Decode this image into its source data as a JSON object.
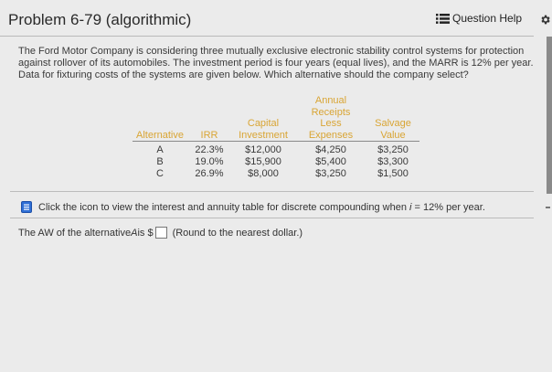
{
  "header": {
    "title": "Problem 6-79 (algorithmic)",
    "question_help": "Question Help"
  },
  "problem": {
    "text": "The Ford Motor Company is considering three mutually exclusive electronic stability control systems for protection against rollover of its automobiles. The investment period is four years (equal lives), and the MARR is 12% per year. Data for fixturing costs of the systems are given below. Which alternative should the company select?"
  },
  "table": {
    "headers": {
      "alternative": "Alternative",
      "irr": "IRR",
      "capital": [
        "Capital",
        "Investment"
      ],
      "annual": [
        "Annual",
        "Receipts",
        "Less",
        "Expenses"
      ],
      "salvage": [
        "Salvage",
        "Value"
      ]
    },
    "rows": [
      {
        "alt": "A",
        "irr": "22.3%",
        "capital": "$12,000",
        "annual": "$4,250",
        "salvage": "$3,250"
      },
      {
        "alt": "B",
        "irr": "19.0%",
        "capital": "$15,900",
        "annual": "$5,400",
        "salvage": "$3,300"
      },
      {
        "alt": "C",
        "irr": "26.9%",
        "capital": "$8,000",
        "annual": "$3,250",
        "salvage": "$1,500"
      }
    ]
  },
  "note": {
    "before": "Click the icon to view the interest and annuity table for discrete compounding when ",
    "var": "i",
    "after": " = 12% per year."
  },
  "answer": {
    "prefix": "The AW of the alternative ",
    "alt": "A",
    "mid": " is $",
    "hint": "(Round to the nearest dollar.)",
    "value": ""
  },
  "colors": {
    "header_text": "#d9a534",
    "note_icon": "#2f6fd6",
    "background": "#ebebeb"
  },
  "icons": [
    "list-icon",
    "gear-icon",
    "document-icon"
  ]
}
